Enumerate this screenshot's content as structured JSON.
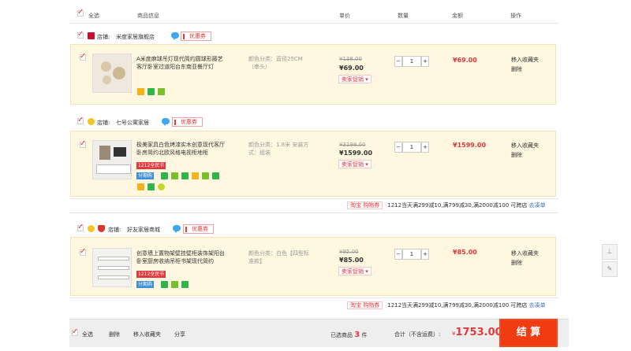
{
  "header": {
    "select_all": "全选",
    "product_info": "商品信息",
    "unit_price": "单价",
    "quantity": "数量",
    "amount": "金额",
    "operation": "操作"
  },
  "shops": [
    {
      "label": "店铺:",
      "name": "米度家居旗舰店",
      "coupon": "优惠券",
      "item": {
        "title": "A米度麻球吊灯现代简约圆球形藤艺客厅卧室过道阳台东南亚餐厅灯",
        "sku": "颜色分类：直径25CM（串头）",
        "old_price": "¥138.00",
        "price": "¥69.00",
        "promo": "卖家促销 ▾",
        "qty": "1",
        "total": "¥69.00",
        "ops": [
          "移入收藏夹",
          "删除"
        ]
      }
    },
    {
      "label": "店铺:",
      "name": "七号公寓家居",
      "coupon": "优惠券",
      "item": {
        "title": "极美家具白色烤漆实木创意现代客厅卧房简约北欧风格电视柜地柜",
        "sku": "颜色分类：1.8米 安装方式：组装",
        "old_price": "¥3198.00",
        "price": "¥1599.00",
        "promo": "卖家促销 ▾",
        "badge": "1212全民节",
        "installment": "分期购",
        "qty": "1",
        "total": "¥1599.00",
        "ops": [
          "移入收藏夹",
          "删除"
        ]
      },
      "promo_tag": "淘宝 购物券",
      "promo_text": "1212当天满299减10,满799减30,满2000减100 可跨店",
      "promo_link": "去凑单"
    },
    {
      "label": "店铺:",
      "name": "好友家居商城",
      "coupon": "优惠券",
      "item": {
        "title": "创意墙上置物架壁挂壁柜装饰架阳台卧室厨房收纳吊柜书架现代简约",
        "sku": "颜色分类：白色【四型标准款】",
        "old_price": "¥95.00",
        "price": "¥85.00",
        "promo": "卖家促销 ▾",
        "badge": "1212全民节",
        "installment": "分期购",
        "qty": "1",
        "total": "¥85.00",
        "ops": [
          "移入收藏夹",
          "删除"
        ]
      },
      "promo_tag": "淘宝 购物券",
      "promo_text": "1212当天满299减10,满799减30,满2000减100 可跨店",
      "promo_link": "去凑单"
    }
  ],
  "footer": {
    "select_all": "全选",
    "delete": "删除",
    "move_fav": "移入收藏夹",
    "share": "分享",
    "selected_prefix": "已选商品",
    "selected_count": "3",
    "selected_suffix": "件",
    "total_label": "合计（不含运费）:",
    "total_currency": "¥",
    "total_value": "1753.00",
    "checkout": "结 算"
  },
  "colors": {
    "accent": "#e4393c",
    "checkout": "#f13c12",
    "item_bg": "#fff7e0"
  }
}
